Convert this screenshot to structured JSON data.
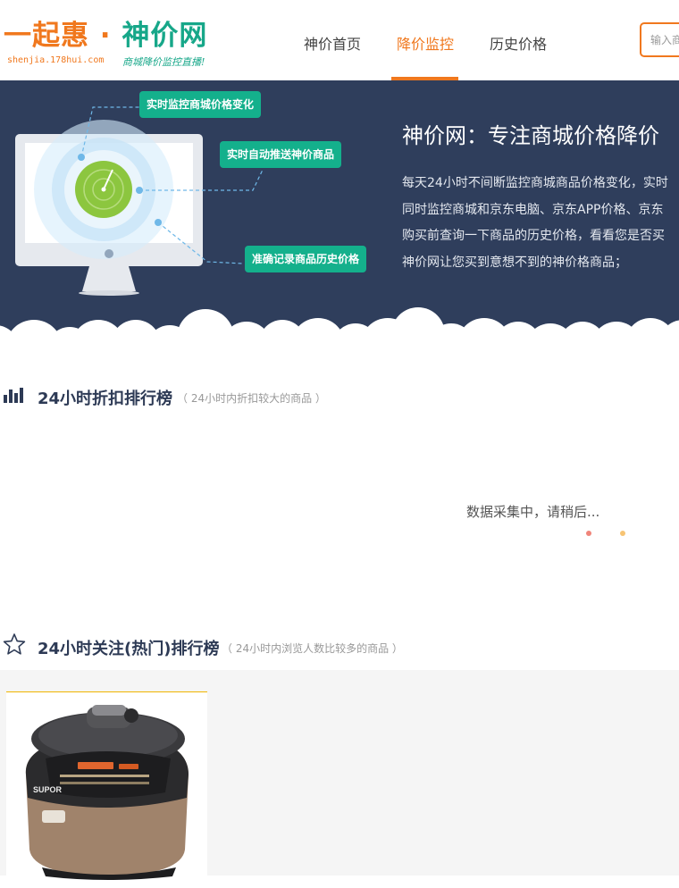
{
  "logo": {
    "part1": "一起惠",
    "dot": "·",
    "part2": "神价网",
    "url": "shenjia.178hui.com",
    "slogan": "商城降价监控直播!"
  },
  "nav": {
    "items": [
      {
        "label": "神价首页",
        "active": false
      },
      {
        "label": "降价监控",
        "active": true
      },
      {
        "label": "历史价格",
        "active": false
      }
    ]
  },
  "search": {
    "placeholder": "输入商品"
  },
  "banner": {
    "tags": [
      "实时监控商城价格变化",
      "实时自动推送神价商品",
      "准确记录商品历史价格"
    ],
    "title": "神价网：专注商城价格降价",
    "lines": [
      "每天24小时不间断监控商城商品价格变化，实时",
      "同时监控商城和京东电脑、京东APP价格、京东",
      "购买前查询一下商品的历史价格，看看您是否买",
      "神价网让您买到意想不到的神价格商品；"
    ]
  },
  "discount_rank": {
    "title": "24小时折扣排行榜",
    "subtitle": "（ 24小时内折扣较大的商品 ）",
    "loading": "数据采集中，请稍后..."
  },
  "hot_rank": {
    "title": "24小时关注(热门)排行榜",
    "subtitle": "（ 24小时内浏览人数比较多的商品 ）"
  },
  "product": {
    "brand": "SUPOR"
  },
  "colors": {
    "brand_orange": "#f0781e",
    "brand_green": "#17a789",
    "banner_bg": "#2f3e5c",
    "tag_green": "#14b08c"
  }
}
